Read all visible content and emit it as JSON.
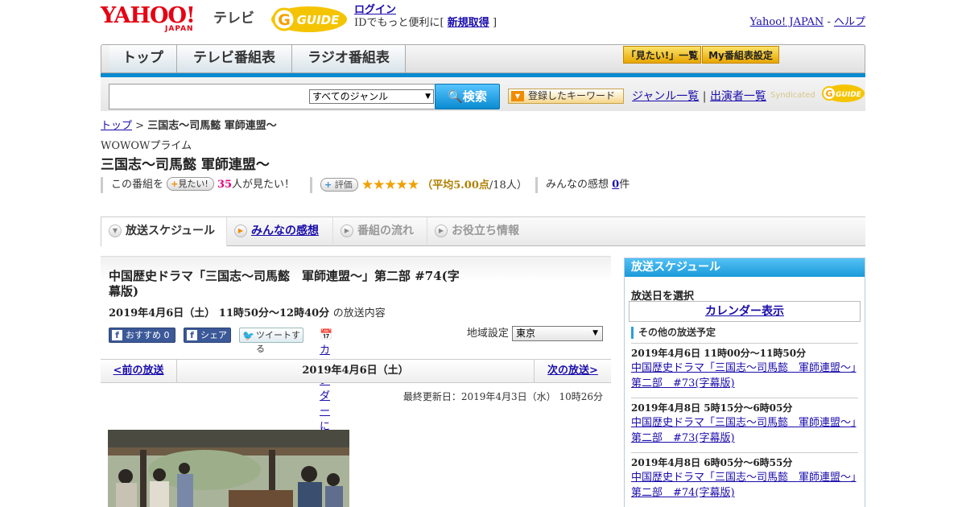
{
  "header": {
    "logo_text": "YAHOO!",
    "logo_sub": "JAPAN",
    "tv_label": "テレビ",
    "gguide_logo": "G-GUIDE",
    "login": "ログイン",
    "login_note_prefix": "IDでもっと便利に[",
    "register": "新規取得",
    "login_note_suffix": "]",
    "yahoo_japan": "Yahoo! JAPAN",
    "sep": "-",
    "help": "ヘルプ"
  },
  "nav": {
    "tabs": [
      "トップ",
      "テレビ番組表",
      "ラジオ番組表"
    ],
    "want_list": "「見たい!」一覧",
    "my_schedule": "My番組表設定"
  },
  "search": {
    "placeholder": "",
    "genre": "すべてのジャンル",
    "button": "検索",
    "keyword_btn": "登録したキーワード",
    "genre_list": "ジャンル一覧",
    "divider": "|",
    "performer_list": "出演者一覧",
    "syndicated": "Syndicated"
  },
  "breadcrumb": {
    "top": "トップ",
    "sep": ">",
    "current": "三国志～司馬懿 軍師連盟～"
  },
  "program": {
    "channel": "WOWOWプライム",
    "title": "三国志～司馬懿 軍師連盟～",
    "want_prefix": "この番組を",
    "want_btn": "見たい!",
    "want_count": "35",
    "want_suffix": "人が見たい！",
    "rate_btn": "評価",
    "stars": "★★★★★",
    "avg_open": "（",
    "avg_label": "平均5.00点",
    "avg_count": "/18人）",
    "impressions_label": "みんなの感想",
    "impressions_count": "0",
    "impressions_unit": "件"
  },
  "tabs": [
    {
      "label": "放送スケジュール"
    },
    {
      "label": "みんなの感想"
    },
    {
      "label": "番組の流れ"
    },
    {
      "label": "お役立ち情報"
    }
  ],
  "episode": {
    "title": "中国歴史ドラマ「三国志～司馬懿　軍師連盟～」第二部 #74(字幕版)",
    "datetime": "2019年4月6日（土） 11時50分～12時40分",
    "datetime_suffix": "の放送内容",
    "fb_like": "おすすめ 0",
    "fb_share": "シェア",
    "tweet": "ツイートする",
    "calendar": "カレンダーに登録",
    "region_label": "地域設定",
    "region_value": "東京",
    "prev": "<前の放送",
    "current_date": "2019年4月6日（土）",
    "next": "次の放送>",
    "updated": "最終更新日：2019年4月3日（水） 10時26分"
  },
  "sidebar": {
    "header": "放送スケジュール",
    "select_label": "放送日を選択",
    "calendar_btn": "カレンダー表示",
    "other_label": "その他の放送予定",
    "items": [
      {
        "date": "2019年4月6日 11時00分～11時50分",
        "title": "中国歴史ドラマ「三国志～司馬懿　軍師連盟～」第二部　#73(字幕版)"
      },
      {
        "date": "2019年4月8日 5時15分～6時05分",
        "title": "中国歴史ドラマ「三国志～司馬懿　軍師連盟～」第二部　#73(字幕版)"
      },
      {
        "date": "2019年4月8日 6時05分～6時55分",
        "title": "中国歴史ドラマ「三国志～司馬懿　軍師連盟～」第二部　#74(字幕版)"
      }
    ]
  },
  "colors": {
    "brand_red": "#e60012",
    "accent_blue": "#0a8bd1",
    "link": "#1a0dab",
    "star": "#f0a000"
  }
}
